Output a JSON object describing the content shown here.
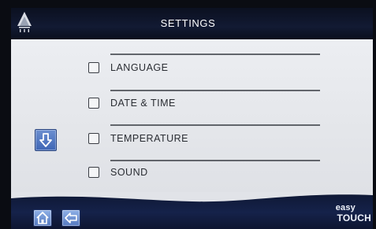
{
  "header": {
    "title": "SETTINGS",
    "logo_icon": "snowflake-tree-logo-icon"
  },
  "menu": {
    "items": [
      {
        "label": "LANGUAGE",
        "checked": false
      },
      {
        "label": "DATE & TIME",
        "checked": false
      },
      {
        "label": "TEMPERATURE",
        "checked": false
      },
      {
        "label": "SOUND",
        "checked": false
      }
    ],
    "scroll_icon": "arrow-down-icon"
  },
  "footer": {
    "home_icon": "home-icon",
    "back_icon": "back-arrow-icon",
    "brand_top": "easy",
    "brand_bottom": "TOUCH"
  },
  "colors": {
    "header_bg": "#0b1020",
    "content_bg": "#e6e8ec",
    "footer_bg": "#15224a",
    "button_blue": "#5579c0",
    "text": "#2a2d33"
  }
}
